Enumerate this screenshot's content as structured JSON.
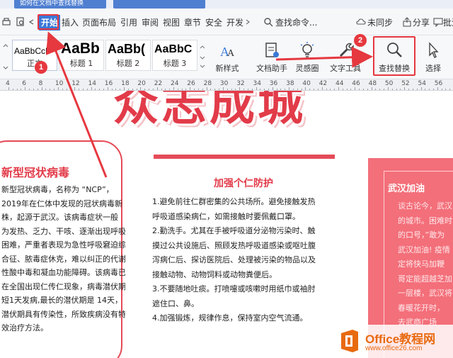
{
  "titlebar": {
    "doc_tab": "如何在文档中查找替换"
  },
  "menubar": {
    "tabs": [
      "开始",
      "插入",
      "页面布局",
      "引用",
      "审阅",
      "视图",
      "章节",
      "安全",
      "开发"
    ],
    "search_command": "查找命令...",
    "sync": "未同步",
    "share": "分享",
    "comment": "批注"
  },
  "ribbon": {
    "styles": [
      {
        "sample": "AaBbCcD",
        "label": "正文"
      },
      {
        "sample": "AaBb",
        "label": "标题 1"
      },
      {
        "sample": "AaBb(",
        "label": "标题 2"
      },
      {
        "sample": "AaBbC",
        "label": "标题 3"
      }
    ],
    "new_style": "新样式",
    "doc_helper": "文档助手",
    "inspiration": "灵感圈",
    "text_tools": "文字工具",
    "find_replace": "查找替换",
    "select": "选择"
  },
  "annotations": {
    "badge1": "1",
    "badge2": "2"
  },
  "ruler": {
    "numbers": [
      "4",
      "6",
      "8",
      "10",
      "12",
      "14",
      "16",
      "18",
      "20",
      "22",
      "24",
      "26",
      "28",
      "30",
      "32",
      "34",
      "36",
      "38",
      "40",
      "42",
      "44",
      "46",
      "48",
      "50",
      "52",
      "54",
      "56"
    ]
  },
  "document": {
    "banner": "众志成城",
    "left_card": {
      "title": "新型冠状病毒",
      "lines": [
        "新型冠状病毒，名称为 “NCP”，",
        "2019年在仁体中发现的冠状病毒新",
        "株，起源于武汉。该病毒症状一般",
        "为发热、乏力、干咳、逐渐出现呼吸",
        "困难，严重者表现为急性呼吸窘迫综",
        "合征、脓毒症休克，难以纠正的代谢",
        "性酸中毒和凝血功能障碍。该病毒已",
        "在全国出现仁传仁现象，病毒潜伏期最",
        "短1天发病,最长的潜伏期是 14天，",
        "潜伏期具有传染性，所致疾病没有特",
        "效治疗方法。"
      ]
    },
    "mid_card": {
      "title": "加强个仁防护",
      "lines": [
        "1.避免前往仁群密集的公共场所。避免接触发热",
        "呼吸道感染病仁，如需接触时要佩戴口罩。",
        "2.勤洗手。尤其在手被呼吸道分泌物污染时、触",
        "摸过公共设施后、照顾发热呼吸道感染或呕吐腹",
        "泻病仁后、探访医院后、处理被污染的物品以及",
        "接触动物、动物饲料或动物粪便后。",
        "3.不要随地吐痰。打喷嚏或咳嗽时用纸巾或袖肘",
        "遮住口、鼻。",
        "4.加强锻炼，规律作息，保持室内空气流通。"
      ]
    },
    "right_card": {
      "title": "武汉加油",
      "lines": [
        "谈古论今，武汉",
        "的城市。困难时",
        "的口号，”敢为",
        "武汉加油! 疫情",
        "定将快马加鞭",
        "哥定能超越芝加",
        "一层楼，武汉将",
        "春暖花开时，",
        "去武商广场"
      ]
    }
  },
  "watermark": {
    "brand": "Office教程网",
    "url": "www.office26.com"
  },
  "colors": {
    "accent_red": "#e6383f",
    "card_red": "#e44b58",
    "ribbon_blue": "#3b78d8"
  }
}
